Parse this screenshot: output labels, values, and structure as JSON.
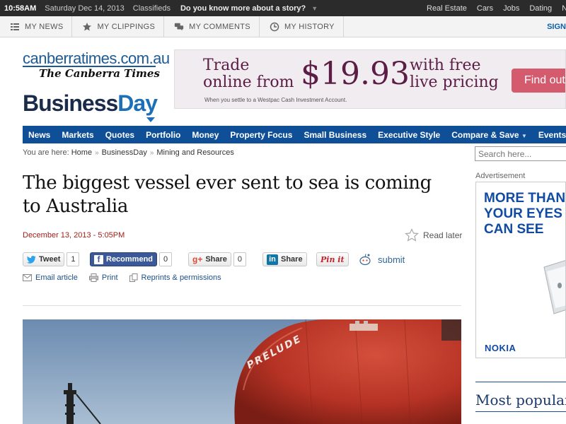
{
  "topbar": {
    "time": "10:58AM",
    "date": "Saturday Dec 14, 2013",
    "classifieds": "Classifieds",
    "question": "Do you know more about a story?",
    "links": [
      "Real Estate",
      "Cars",
      "Jobs",
      "Dating",
      "New"
    ]
  },
  "subbar": {
    "tabs": [
      "MY NEWS",
      "MY CLIPPINGS",
      "MY COMMENTS",
      "MY HISTORY"
    ],
    "sign": "SIGN"
  },
  "header": {
    "site_a": "canberratimes",
    "site_b": ".com.au",
    "masthead": "The Canberra Times",
    "section_a": "Business",
    "section_b": "Day"
  },
  "banner": {
    "line1": "Trade",
    "line2": "online from",
    "price": "$19.93",
    "free1": "with free",
    "free2": "live pricing",
    "note": "When you settle to a Westpac Cash Investment Account.",
    "cta": "Find out"
  },
  "nav": {
    "items": [
      "News",
      "Markets",
      "Quotes",
      "Portfolio",
      "Money",
      "Property Focus",
      "Small Business",
      "Executive Style",
      "Compare & Save",
      "Events"
    ]
  },
  "breadcrumb": {
    "prefix": "You are here:",
    "items": [
      "Home",
      "BusinessDay",
      "Mining and Resources"
    ]
  },
  "search": {
    "placeholder": "Search here..."
  },
  "article": {
    "headline": "The biggest vessel ever sent to sea is coming to Australia",
    "date": "December 13, 2013 - 5:05PM",
    "read_later": "Read later",
    "ship_name": "PRELUDE"
  },
  "share": {
    "tweet": "Tweet",
    "tweet_count": "1",
    "recommend": "Recommend",
    "recommend_count": "0",
    "gplus": "Share",
    "gplus_count": "0",
    "linkedin": "Share",
    "pinit": "Pin it",
    "submit": "submit"
  },
  "tools": {
    "email": "Email article",
    "print": "Print",
    "reprints": "Reprints & permissions"
  },
  "sidebar": {
    "advertisement": "Advertisement",
    "ad_line1": "MORE THAN",
    "ad_line2": "YOUR EYES",
    "ad_line3": "CAN SEE",
    "ad_brand": "NOKIA",
    "most_popular": "Most popular"
  },
  "colors": {
    "nav_blue": "#0e4f97",
    "date_red": "#a0211a",
    "banner_purple": "#5b1d46",
    "ship_red": "#c23a2a"
  }
}
